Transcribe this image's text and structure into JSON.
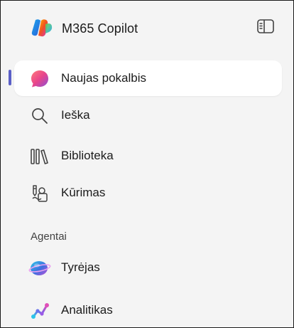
{
  "header": {
    "app_title": "M365 Copilot",
    "logo_icon": "copilot-logo-icon",
    "toggle_icon": "sidebar-toggle-icon"
  },
  "nav": {
    "items": [
      {
        "label": "Naujas pokalbis",
        "icon": "new-chat-icon",
        "active": true
      },
      {
        "label": "Ieška",
        "icon": "search-icon",
        "active": false
      },
      {
        "label": "Biblioteka",
        "icon": "library-icon",
        "active": false
      },
      {
        "label": "Kūrimas",
        "icon": "create-icon",
        "active": false
      }
    ]
  },
  "agents": {
    "section_label": "Agentai",
    "items": [
      {
        "label": "Tyrėjas",
        "icon": "researcher-icon"
      },
      {
        "label": "Analitikas",
        "icon": "analyst-icon"
      }
    ]
  },
  "colors": {
    "accent": "#5b5fc7",
    "sidebar_bg": "#f4f4f4",
    "active_bg": "#ffffff",
    "text": "#1b1b1b"
  }
}
